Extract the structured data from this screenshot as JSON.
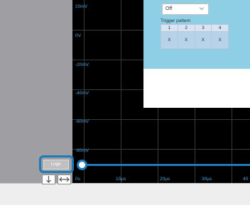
{
  "scope": {
    "y_labels": [
      "20mV",
      "0V",
      "-20mV",
      "-40mV",
      "-60mV",
      "-80mV"
    ],
    "x_labels": [
      "0s",
      "10µs",
      "20µs",
      "30µs",
      "40"
    ]
  },
  "popup": {
    "dropdown_value": "Off",
    "trigger_label": "Trigger pattern",
    "columns": [
      "1",
      "2",
      "3",
      "4"
    ],
    "values": [
      "X",
      "X",
      "X",
      "X"
    ]
  },
  "logic_button": {
    "label": "Logic"
  },
  "icons": {
    "dropdown": "chevron-down-icon",
    "down": "arrow-down-icon",
    "width": "horizontal-resize-icon"
  },
  "colors": {
    "accent": "#1f7ab8",
    "scope_bg": "#000000",
    "label": "#4da3e0",
    "popup_blue": "#8ecfe6"
  }
}
